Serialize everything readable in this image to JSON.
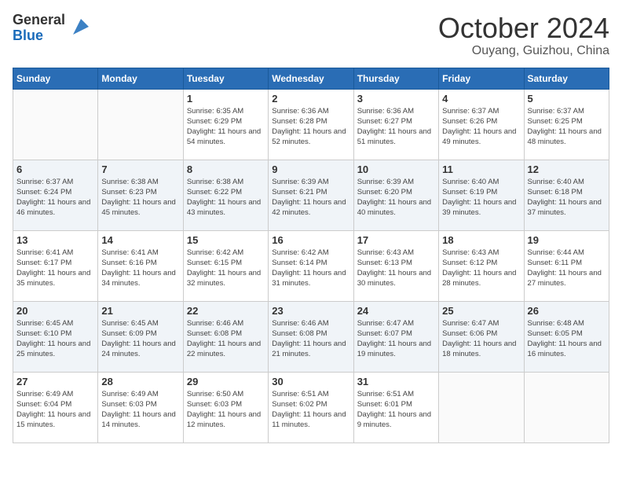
{
  "header": {
    "logo_general": "General",
    "logo_blue": "Blue",
    "month_title": "October 2024",
    "location": "Ouyang, Guizhou, China"
  },
  "days_of_week": [
    "Sunday",
    "Monday",
    "Tuesday",
    "Wednesday",
    "Thursday",
    "Friday",
    "Saturday"
  ],
  "weeks": [
    [
      {
        "day": "",
        "info": ""
      },
      {
        "day": "",
        "info": ""
      },
      {
        "day": "1",
        "info": "Sunrise: 6:35 AM\nSunset: 6:29 PM\nDaylight: 11 hours and 54 minutes."
      },
      {
        "day": "2",
        "info": "Sunrise: 6:36 AM\nSunset: 6:28 PM\nDaylight: 11 hours and 52 minutes."
      },
      {
        "day": "3",
        "info": "Sunrise: 6:36 AM\nSunset: 6:27 PM\nDaylight: 11 hours and 51 minutes."
      },
      {
        "day": "4",
        "info": "Sunrise: 6:37 AM\nSunset: 6:26 PM\nDaylight: 11 hours and 49 minutes."
      },
      {
        "day": "5",
        "info": "Sunrise: 6:37 AM\nSunset: 6:25 PM\nDaylight: 11 hours and 48 minutes."
      }
    ],
    [
      {
        "day": "6",
        "info": "Sunrise: 6:37 AM\nSunset: 6:24 PM\nDaylight: 11 hours and 46 minutes."
      },
      {
        "day": "7",
        "info": "Sunrise: 6:38 AM\nSunset: 6:23 PM\nDaylight: 11 hours and 45 minutes."
      },
      {
        "day": "8",
        "info": "Sunrise: 6:38 AM\nSunset: 6:22 PM\nDaylight: 11 hours and 43 minutes."
      },
      {
        "day": "9",
        "info": "Sunrise: 6:39 AM\nSunset: 6:21 PM\nDaylight: 11 hours and 42 minutes."
      },
      {
        "day": "10",
        "info": "Sunrise: 6:39 AM\nSunset: 6:20 PM\nDaylight: 11 hours and 40 minutes."
      },
      {
        "day": "11",
        "info": "Sunrise: 6:40 AM\nSunset: 6:19 PM\nDaylight: 11 hours and 39 minutes."
      },
      {
        "day": "12",
        "info": "Sunrise: 6:40 AM\nSunset: 6:18 PM\nDaylight: 11 hours and 37 minutes."
      }
    ],
    [
      {
        "day": "13",
        "info": "Sunrise: 6:41 AM\nSunset: 6:17 PM\nDaylight: 11 hours and 35 minutes."
      },
      {
        "day": "14",
        "info": "Sunrise: 6:41 AM\nSunset: 6:16 PM\nDaylight: 11 hours and 34 minutes."
      },
      {
        "day": "15",
        "info": "Sunrise: 6:42 AM\nSunset: 6:15 PM\nDaylight: 11 hours and 32 minutes."
      },
      {
        "day": "16",
        "info": "Sunrise: 6:42 AM\nSunset: 6:14 PM\nDaylight: 11 hours and 31 minutes."
      },
      {
        "day": "17",
        "info": "Sunrise: 6:43 AM\nSunset: 6:13 PM\nDaylight: 11 hours and 30 minutes."
      },
      {
        "day": "18",
        "info": "Sunrise: 6:43 AM\nSunset: 6:12 PM\nDaylight: 11 hours and 28 minutes."
      },
      {
        "day": "19",
        "info": "Sunrise: 6:44 AM\nSunset: 6:11 PM\nDaylight: 11 hours and 27 minutes."
      }
    ],
    [
      {
        "day": "20",
        "info": "Sunrise: 6:45 AM\nSunset: 6:10 PM\nDaylight: 11 hours and 25 minutes."
      },
      {
        "day": "21",
        "info": "Sunrise: 6:45 AM\nSunset: 6:09 PM\nDaylight: 11 hours and 24 minutes."
      },
      {
        "day": "22",
        "info": "Sunrise: 6:46 AM\nSunset: 6:08 PM\nDaylight: 11 hours and 22 minutes."
      },
      {
        "day": "23",
        "info": "Sunrise: 6:46 AM\nSunset: 6:08 PM\nDaylight: 11 hours and 21 minutes."
      },
      {
        "day": "24",
        "info": "Sunrise: 6:47 AM\nSunset: 6:07 PM\nDaylight: 11 hours and 19 minutes."
      },
      {
        "day": "25",
        "info": "Sunrise: 6:47 AM\nSunset: 6:06 PM\nDaylight: 11 hours and 18 minutes."
      },
      {
        "day": "26",
        "info": "Sunrise: 6:48 AM\nSunset: 6:05 PM\nDaylight: 11 hours and 16 minutes."
      }
    ],
    [
      {
        "day": "27",
        "info": "Sunrise: 6:49 AM\nSunset: 6:04 PM\nDaylight: 11 hours and 15 minutes."
      },
      {
        "day": "28",
        "info": "Sunrise: 6:49 AM\nSunset: 6:03 PM\nDaylight: 11 hours and 14 minutes."
      },
      {
        "day": "29",
        "info": "Sunrise: 6:50 AM\nSunset: 6:03 PM\nDaylight: 11 hours and 12 minutes."
      },
      {
        "day": "30",
        "info": "Sunrise: 6:51 AM\nSunset: 6:02 PM\nDaylight: 11 hours and 11 minutes."
      },
      {
        "day": "31",
        "info": "Sunrise: 6:51 AM\nSunset: 6:01 PM\nDaylight: 11 hours and 9 minutes."
      },
      {
        "day": "",
        "info": ""
      },
      {
        "day": "",
        "info": ""
      }
    ]
  ]
}
